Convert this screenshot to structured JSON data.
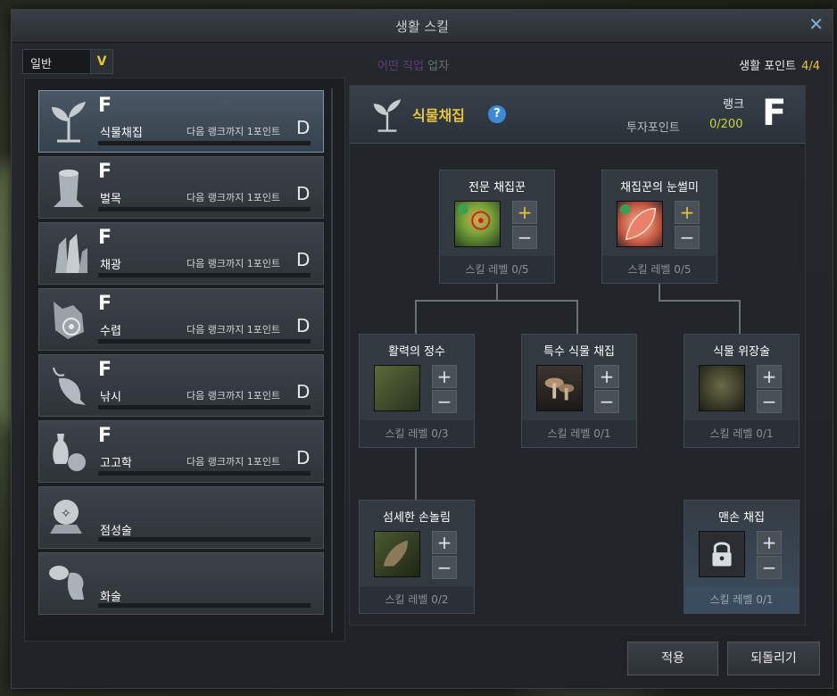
{
  "window": {
    "title": "생활 스킬"
  },
  "category_select": {
    "value": "일반"
  },
  "faded_tab": {
    "a": "어떤 직업",
    "b": "업자"
  },
  "life_points": {
    "label": "생활 포인트",
    "value": "4/4"
  },
  "categories": [
    {
      "name": "식물채집",
      "rank": "F",
      "hint": "다음 랭크까지 1포인트",
      "next_rank": "D",
      "icon": "sprout-icon"
    },
    {
      "name": "벌목",
      "rank": "F",
      "hint": "다음 랭크까지 1포인트",
      "next_rank": "D",
      "icon": "tree-stump-icon"
    },
    {
      "name": "채광",
      "rank": "F",
      "hint": "다음 랭크까지 1포인트",
      "next_rank": "D",
      "icon": "crystal-icon"
    },
    {
      "name": "수렵",
      "rank": "F",
      "hint": "다음 랭크까지 1포인트",
      "next_rank": "D",
      "icon": "wolf-target-icon"
    },
    {
      "name": "낚시",
      "rank": "F",
      "hint": "다음 랭크까지 1포인트",
      "next_rank": "D",
      "icon": "fish-icon"
    },
    {
      "name": "고고학",
      "rank": "F",
      "hint": "다음 랭크까지 1포인트",
      "next_rank": "D",
      "icon": "vase-icon"
    },
    {
      "name": "점성술",
      "icon": "astrology-icon"
    },
    {
      "name": "화술",
      "icon": "speech-icon"
    }
  ],
  "detail": {
    "title": "식물채집",
    "help": "?",
    "rank_label": "랭크",
    "rank": "F",
    "invest_label": "투자포인트",
    "invest_value": "0/200"
  },
  "nodes": [
    {
      "name": "전문 채집꾼",
      "level": "스킬 레벨 0/5",
      "icon": "herb-target-icon"
    },
    {
      "name": "채집꾼의 눈썰미",
      "level": "스킬 레벨 0/5",
      "icon": "leaf-icon"
    },
    {
      "name": "활력의 정수",
      "level": "스킬 레벨 0/3",
      "icon": "tree-spirit-icon"
    },
    {
      "name": "특수 식물 채집",
      "level": "스킬 레벨 0/1",
      "icon": "mushroom-icon"
    },
    {
      "name": "식물 위장술",
      "level": "스킬 레벨 0/1",
      "icon": "ghillie-icon"
    },
    {
      "name": "섬세한 손놀림",
      "level": "스킬 레벨 0/2",
      "icon": "hand-icon"
    },
    {
      "name": "맨손 채집",
      "level": "스킬 레벨 0/1",
      "icon": "lock-icon"
    }
  ],
  "buttons": {
    "plus": "+",
    "minus": "−",
    "apply": "적용",
    "revert": "되돌리기",
    "close": "✕",
    "dropdown_arrow": "V"
  }
}
